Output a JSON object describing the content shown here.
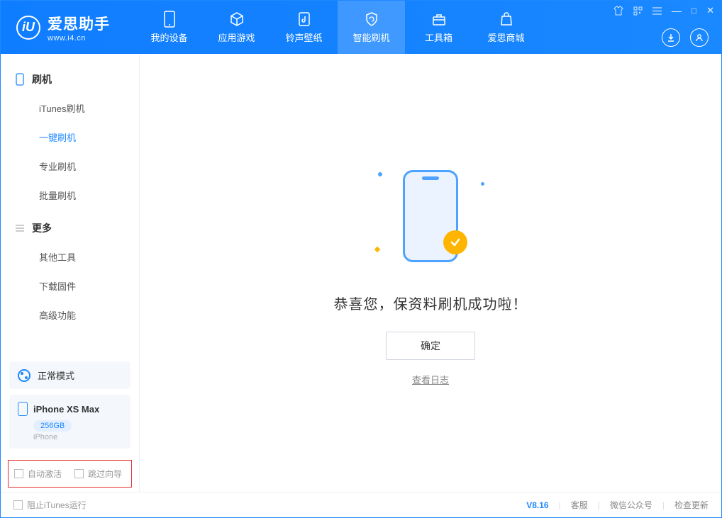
{
  "app": {
    "name": "爱思助手",
    "url": "www.i4.cn",
    "logo_letter": "iU"
  },
  "nav": [
    {
      "label": "我的设备",
      "icon": "device-icon"
    },
    {
      "label": "应用游戏",
      "icon": "cube-icon"
    },
    {
      "label": "铃声壁纸",
      "icon": "music-file-icon"
    },
    {
      "label": "智能刷机",
      "icon": "refresh-shield-icon",
      "active": true
    },
    {
      "label": "工具箱",
      "icon": "toolbox-icon"
    },
    {
      "label": "爱思商城",
      "icon": "bag-icon"
    }
  ],
  "window_controls": {
    "tshirt": "tshirt-icon",
    "qr": "qr-icon",
    "menu": "menu-icon",
    "minimize": "—",
    "maximize": "□",
    "close": "✕"
  },
  "header_actions": {
    "download": "download-icon",
    "user": "user-icon"
  },
  "sidebar": {
    "sections": [
      {
        "title": "刷机",
        "icon": "phone-outline-icon",
        "items": [
          "iTunes刷机",
          "一键刷机",
          "专业刷机",
          "批量刷机"
        ],
        "active_index": 1
      },
      {
        "title": "更多",
        "icon": "menu-lines-icon",
        "items": [
          "其他工具",
          "下载固件",
          "高级功能"
        ]
      }
    ],
    "mode": {
      "label": "正常模式"
    },
    "device": {
      "name": "iPhone XS Max",
      "storage": "256GB",
      "type": "iPhone"
    },
    "checkboxes": {
      "auto_activate": "自动激活",
      "skip_guide": "跳过向导"
    }
  },
  "main": {
    "success_text": "恭喜您，保资料刷机成功啦！",
    "ok_button": "确定",
    "log_link": "查看日志"
  },
  "footer": {
    "block_itunes": "阻止iTunes运行",
    "version": "V8.16",
    "links": [
      "客服",
      "微信公众号",
      "检查更新"
    ]
  }
}
